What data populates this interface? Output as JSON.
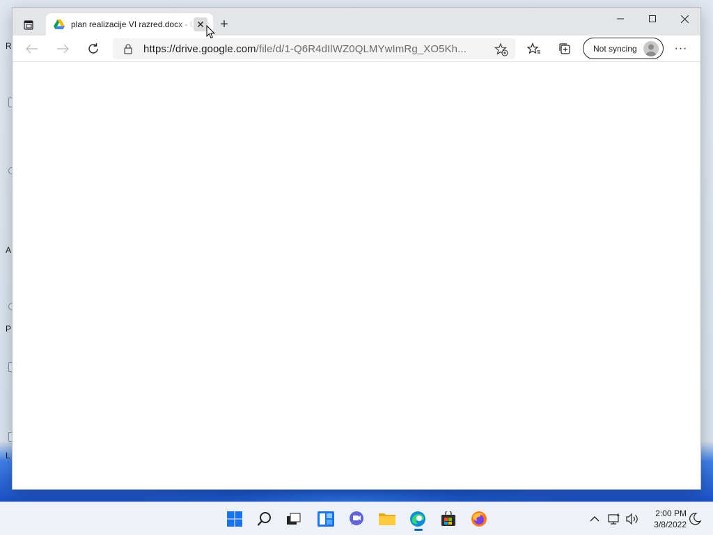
{
  "browser": {
    "tab": {
      "title": "plan realizacije VI razred.docx - Google Drive",
      "favicon": "google-drive-icon",
      "close_glyph": "✕"
    },
    "new_tab_glyph": "+",
    "address": {
      "host": "https://drive.google.com",
      "path": "/file/d/1-Q6R4dIlWZ0QLMYwImRg_XO5Kh..."
    },
    "sync_label": "Not syncing",
    "more_glyph": "···"
  },
  "desktop": {
    "icon_letters": [
      "R",
      "A",
      "P",
      "L"
    ]
  },
  "taskbar": {
    "items": [
      "start-icon",
      "search-icon",
      "task-view-icon",
      "widgets-icon",
      "chat-icon",
      "file-explorer-icon",
      "edge-icon",
      "store-icon",
      "firefox-icon"
    ],
    "clock_time": "2:00 PM",
    "clock_date": "3/8/2022"
  },
  "colors": {
    "accent": "#0067c0",
    "titlebar": "#e3e5e8",
    "address_bg": "#f3f3f3"
  }
}
